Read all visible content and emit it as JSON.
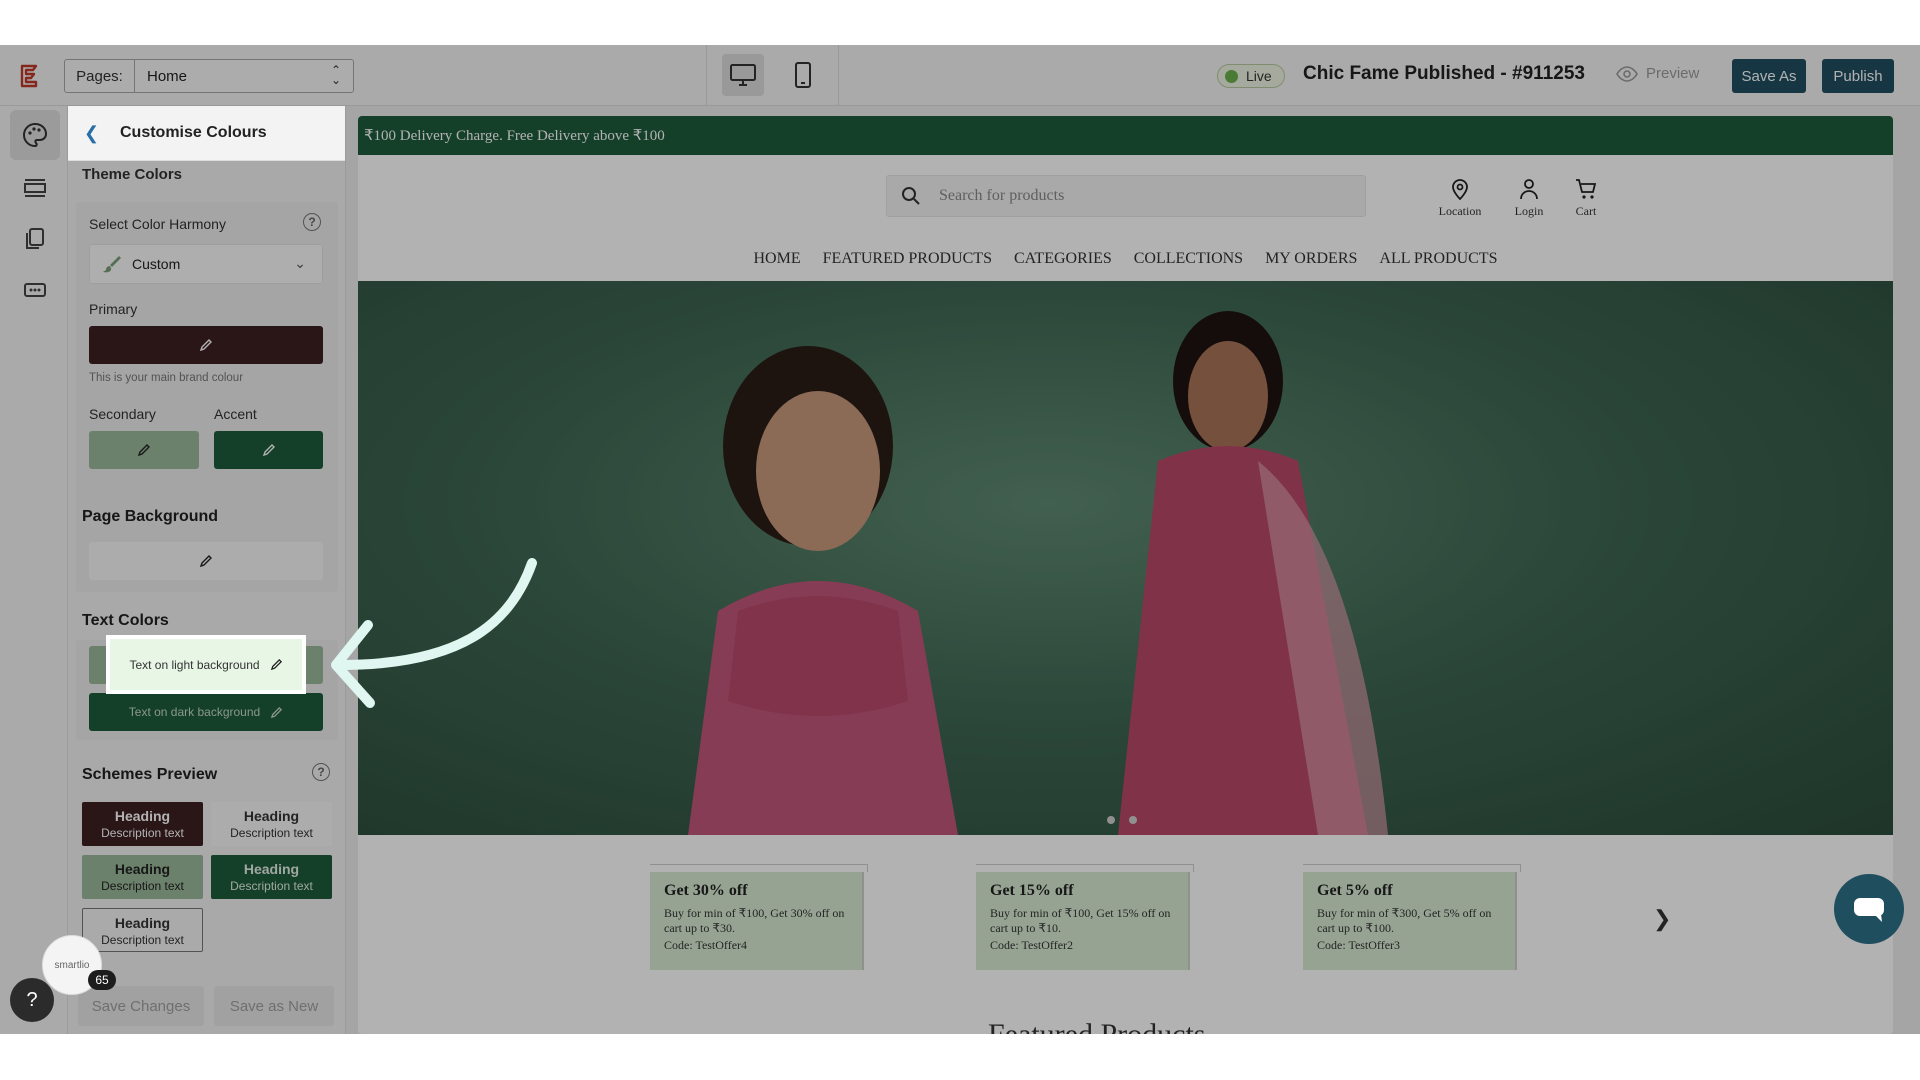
{
  "topbar": {
    "pages_label": "Pages:",
    "pages_value": "Home",
    "live_label": "Live",
    "title": "Chic Fame Published - #911253",
    "preview_label": "Preview",
    "save_as_label": "Save As",
    "publish_label": "Publish"
  },
  "panel": {
    "title": "Customise Colours",
    "cut_section_title": "Theme Colors",
    "harmony_label": "Select Color Harmony",
    "harmony_value": "Custom",
    "primary_label": "Primary",
    "primary_hint": "This is your main brand colour",
    "secondary_label": "Secondary",
    "accent_label": "Accent",
    "page_bg_title": "Page Background",
    "text_colors_title": "Text Colors",
    "text_light_label": "Text on light background",
    "text_dark_label": "Text on dark background",
    "schemes_title": "Schemes Preview",
    "schemes": [
      {
        "heading": "Heading",
        "desc": "Description text"
      },
      {
        "heading": "Heading",
        "desc": "Description text"
      },
      {
        "heading": "Heading",
        "desc": "Description text"
      },
      {
        "heading": "Heading",
        "desc": "Description text"
      },
      {
        "heading": "Heading",
        "desc": "Description text"
      }
    ],
    "save_changes_label": "Save Changes",
    "save_new_label": "Save as New",
    "colors": {
      "primary": "#3d1f22",
      "secondary": "#9bb99a",
      "accent": "#1d5b3c",
      "page_bg": "#ffffff"
    }
  },
  "site": {
    "announcement": "₹100 Delivery Charge. Free Delivery above ₹100",
    "search_placeholder": "Search for products",
    "header_icons": [
      {
        "label": "Location",
        "icon": "location-pin-icon"
      },
      {
        "label": "Login",
        "icon": "user-icon"
      },
      {
        "label": "Cart",
        "icon": "cart-icon"
      }
    ],
    "nav": [
      "HOME",
      "FEATURED PRODUCTS",
      "CATEGORIES",
      "COLLECTIONS",
      "MY ORDERS",
      "ALL PRODUCTS"
    ],
    "offers": [
      {
        "title": "Get 30% off",
        "body": "Buy for min of ₹100, Get 30% off on cart up to ₹30.",
        "code": "Code: TestOffer4"
      },
      {
        "title": "Get 15% off",
        "body": "Buy for min of ₹100, Get 15% off on cart up to ₹10.",
        "code": "Code: TestOffer2"
      },
      {
        "title": "Get 5% off",
        "body": "Buy for min of ₹300, Get 5% off on cart up to ₹100.",
        "code": "Code: TestOffer3"
      }
    ],
    "section_heading": "Featured Products"
  },
  "widgets": {
    "badge_count": "65",
    "badge_brand": "smartlio"
  }
}
